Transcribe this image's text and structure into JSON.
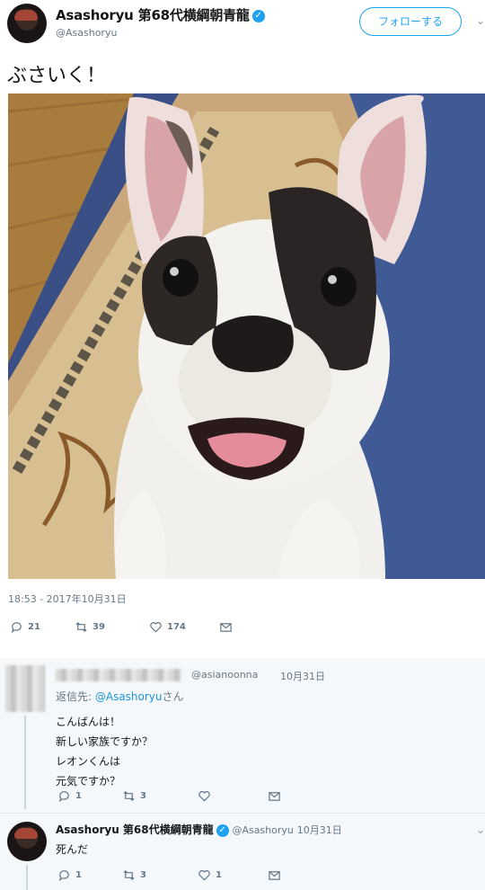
{
  "tweet": {
    "author_name": "Asashoryu 第68代横綱朝青龍",
    "author_handle": "@Asashoryu",
    "follow_label": "フォローする",
    "text": "ぶさいく！",
    "timestamp": "18:53 - 2017年10月31日",
    "replies": "21",
    "retweets": "39",
    "likes": "174"
  },
  "reply1": {
    "handle": "@asianoonna",
    "date": "10月31日",
    "reply_to_prefix": "返信先: ",
    "reply_to_handle": "@Asashoryu",
    "reply_to_suffix": "さん",
    "lines": [
      "こんばんは！",
      "新しい家族ですか？",
      "レオンくんは",
      "元気ですか？"
    ],
    "replies": "1",
    "retweets": "3"
  },
  "reply2": {
    "author_name": "Asashoryu 第68代横綱朝青龍",
    "handle": "@Asashoryu",
    "date": "10月31日",
    "text": "死んだ",
    "replies": "1",
    "retweets": "3",
    "likes": "1"
  },
  "colors": {
    "accent": "#1da1f2",
    "muted": "#657786",
    "reply_bg": "#f5f8fa"
  },
  "icons": [
    "verified-badge-icon",
    "chevron-down-icon",
    "reply-icon",
    "retweet-icon",
    "like-icon",
    "dm-icon"
  ]
}
